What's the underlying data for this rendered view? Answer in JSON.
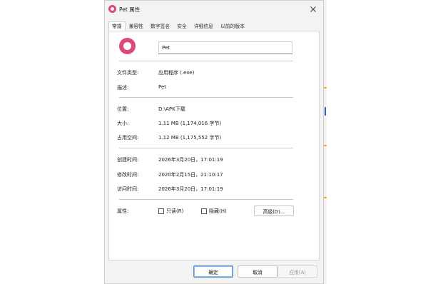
{
  "dialog": {
    "title": "Pet 属性",
    "close_icon": "close-icon"
  },
  "tabs": [
    {
      "label": "常规",
      "active": true
    },
    {
      "label": "兼容性",
      "active": false
    },
    {
      "label": "数字签名",
      "active": false
    },
    {
      "label": "安全",
      "active": false
    },
    {
      "label": "详细信息",
      "active": false
    },
    {
      "label": "以前的版本",
      "active": false
    }
  ],
  "general": {
    "file_name": "Pet",
    "file_type_label": "文件类型:",
    "file_type_value": "应用程序 (.exe)",
    "description_label": "描述:",
    "description_value": "Pet",
    "location_label": "位置:",
    "location_value": "D:\\APK下载",
    "size_label": "大小:",
    "size_value": "1.11 MB (1,174,016 字节)",
    "disk_size_label": "占用空间:",
    "disk_size_value": "1.12 MB (1,175,552 字节)",
    "created_label": "创建时间:",
    "created_value": "2026年3月20日，17:01:19",
    "modified_label": "修改时间:",
    "modified_value": "2020年2月15日，21:10:17",
    "accessed_label": "访问时间:",
    "accessed_value": "2026年3月20日，17:01:19",
    "attributes_label": "属性:",
    "readonly_label": "只读(R)",
    "readonly_checked": false,
    "hidden_label": "隐藏(H)",
    "hidden_checked": false,
    "advanced_label": "高级(D)..."
  },
  "footer": {
    "ok_label": "确定",
    "cancel_label": "取消",
    "apply_label": "应用(A)"
  },
  "colors": {
    "accent": "#dc4a7c",
    "primary_border": "#5a8fd6"
  }
}
